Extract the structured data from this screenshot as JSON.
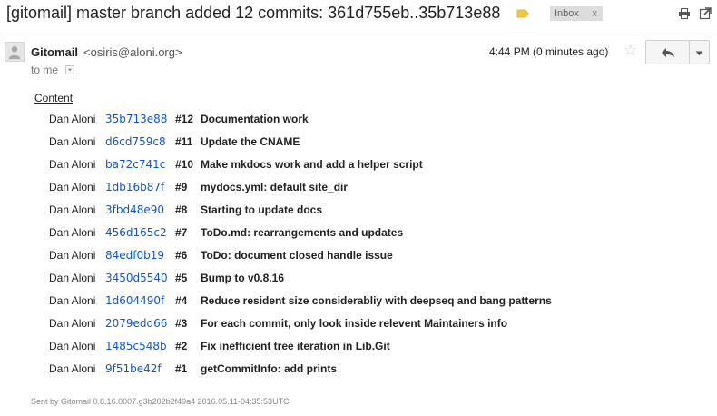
{
  "subject": "[gitomail] master branch added 12 commits: 361d755eb..35b713e88",
  "labels": {
    "inbox": "Inbox",
    "remove": "x"
  },
  "colors": {
    "label_tag": "#f2c744",
    "link": "#1155cc",
    "chip_bg": "#dddddd"
  },
  "icons": {
    "label": "label-tag-icon",
    "print": "print-icon",
    "new_window": "new-window-icon",
    "avatar": "person-avatar-icon",
    "star": "star-icon",
    "reply": "reply-arrow-icon",
    "more": "chevron-down-icon"
  },
  "message": {
    "sender_name": "Gitomail",
    "sender_email": "<osiris@aloni.org>",
    "to": "to me",
    "time": "4:44 PM (0 minutes ago)"
  },
  "content_link": "Content",
  "commits": [
    {
      "author": "Dan Aloni",
      "hash": "35b713e88",
      "num": "#12",
      "message": "Documentation work"
    },
    {
      "author": "Dan Aloni",
      "hash": "d6cd759c8",
      "num": "#11",
      "message": "Update the CNAME"
    },
    {
      "author": "Dan Aloni",
      "hash": "ba72c741c",
      "num": "#10",
      "message": "Make mkdocs work and add a helper script"
    },
    {
      "author": "Dan Aloni",
      "hash": "1db16b87f",
      "num": "#9",
      "message": "mydocs.yml: default site_dir"
    },
    {
      "author": "Dan Aloni",
      "hash": "3fbd48e90",
      "num": "#8",
      "message": "Starting to update docs"
    },
    {
      "author": "Dan Aloni",
      "hash": "456d165c2",
      "num": "#7",
      "message": "ToDo.md: rearrangements and updates"
    },
    {
      "author": "Dan Aloni",
      "hash": "84edf0b19",
      "num": "#6",
      "message": "ToDo: document closed handle issue"
    },
    {
      "author": "Dan Aloni",
      "hash": "3450d5540",
      "num": "#5",
      "message": "Bump to v0.8.16"
    },
    {
      "author": "Dan Aloni",
      "hash": "1d604490f",
      "num": "#4",
      "message": "Reduce resident size considerabliy with deepseq and bang patterns"
    },
    {
      "author": "Dan Aloni",
      "hash": "2079edd66",
      "num": "#3",
      "message": "For each commit, only look inside relevent Maintainers info"
    },
    {
      "author": "Dan Aloni",
      "hash": "1485c548b",
      "num": "#2",
      "message": "Fix inefficient tree iteration in Lib.Git"
    },
    {
      "author": "Dan Aloni",
      "hash": "9f51be42f",
      "num": "#1",
      "message": "getCommitInfo: add prints"
    }
  ],
  "footer": {
    "prefix": "Sent by ",
    "brand": "Gitomail",
    "version": " 0.8.16.0007.g3b202b2f49a4 2016.05.11-04:35:53UTC"
  }
}
